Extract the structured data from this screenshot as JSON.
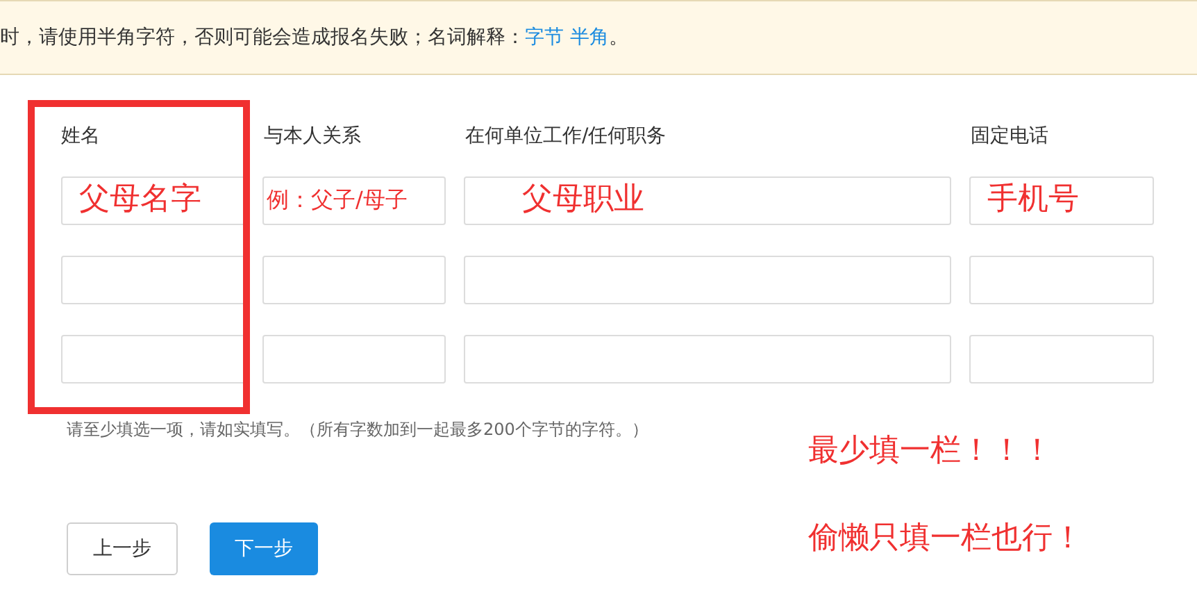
{
  "banner": {
    "text": "时，请使用半角字符，否则可能会造成报名失败；名词解释：",
    "links": [
      "字节",
      "半角"
    ],
    "end": "。"
  },
  "columns": [
    "姓名",
    "与本人关系",
    "在何单位工作/任何职务",
    "固定电话"
  ],
  "form_rows": [
    {
      "kind": "input"
    },
    {
      "kind": "input"
    },
    {
      "kind": "input"
    }
  ],
  "field_notes": [
    "父母名字",
    "例：父子/母子",
    "父母职业",
    "手机号"
  ],
  "hint": "请至少填选一项，请如实填写。（所有字数加到一起最多200个字节的字符。）",
  "side_notes": [
    "最少填一栏！！！",
    "偷懒只填一栏也行！"
  ],
  "buttons": [
    {
      "label": "上一步",
      "kind": "secondary"
    },
    {
      "label": "下一步",
      "kind": "primary"
    }
  ]
}
